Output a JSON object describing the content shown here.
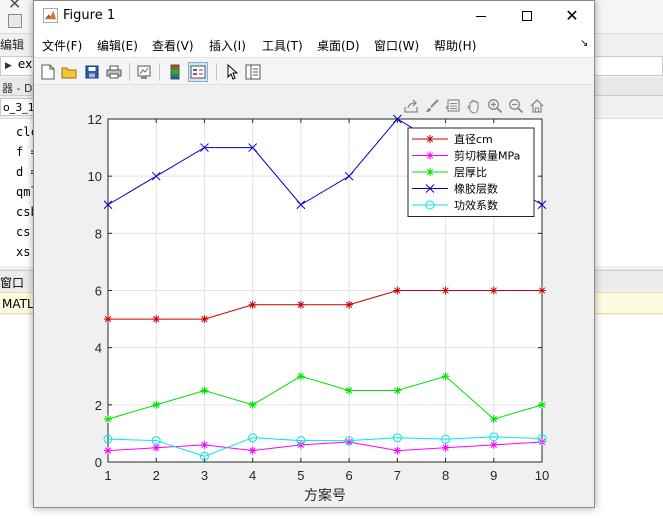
{
  "background": {
    "tab_label": "编辑",
    "address_text": "ex",
    "editor_title": "器 - D",
    "file_tab": "o_3_1",
    "code_lines": [
      "clc",
      "f =",
      "d =",
      "qml",
      "csb",
      "cs",
      "xs"
    ],
    "cmd_title": "窗口",
    "cmd_msg": "MATL"
  },
  "figure": {
    "title": "Figure 1",
    "menu": [
      "文件(F)",
      "编辑(E)",
      "查看(V)",
      "插入(I)",
      "工具(T)",
      "桌面(D)",
      "窗口(W)",
      "帮助(H)"
    ],
    "toolbar": [
      "new-figure",
      "open-file",
      "save",
      "print",
      "link-plot",
      "colorbar",
      "legend",
      "edit-plot",
      "property-inspector"
    ]
  },
  "colors": {
    "red": "#cc0000",
    "magenta": "#ff00ff",
    "green": "#00e000",
    "blue": "#0000cc",
    "cyan": "#00e5ee"
  },
  "chart_data": {
    "type": "line",
    "title": "",
    "xlabel": "方案号",
    "ylabel": "",
    "x": [
      1,
      2,
      3,
      4,
      5,
      6,
      7,
      8,
      9,
      10
    ],
    "xlim": [
      1,
      10
    ],
    "ylim": [
      0,
      12
    ],
    "xticks": [
      1,
      2,
      3,
      4,
      5,
      6,
      7,
      8,
      9,
      10
    ],
    "yticks": [
      0,
      2,
      4,
      6,
      8,
      10,
      12
    ],
    "grid": true,
    "legend_position": "top-right",
    "series": [
      {
        "name": "直径cm",
        "color": "#cc0000",
        "marker": "asterisk",
        "values": [
          5,
          5,
          5,
          5.5,
          5.5,
          5.5,
          6,
          6,
          6,
          6
        ]
      },
      {
        "name": "剪切模量MPa",
        "color": "#ff00ff",
        "marker": "asterisk",
        "values": [
          0.4,
          0.5,
          0.6,
          0.4,
          0.6,
          0.7,
          0.4,
          0.5,
          0.6,
          0.7
        ]
      },
      {
        "name": "层厚比",
        "color": "#00e000",
        "marker": "asterisk",
        "values": [
          1.5,
          2,
          2.5,
          2,
          3,
          2.5,
          2.5,
          3,
          1.5,
          2
        ]
      },
      {
        "name": "橡胶层数",
        "color": "#0000cc",
        "marker": "x",
        "values": [
          9,
          10,
          11,
          11,
          9,
          10,
          12,
          11,
          10,
          9
        ]
      },
      {
        "name": "功效系数",
        "color": "#00e5ee",
        "marker": "circle",
        "values": [
          0.8,
          0.75,
          0.2,
          0.85,
          0.75,
          0.75,
          0.85,
          0.8,
          0.88,
          0.82
        ]
      }
    ]
  }
}
